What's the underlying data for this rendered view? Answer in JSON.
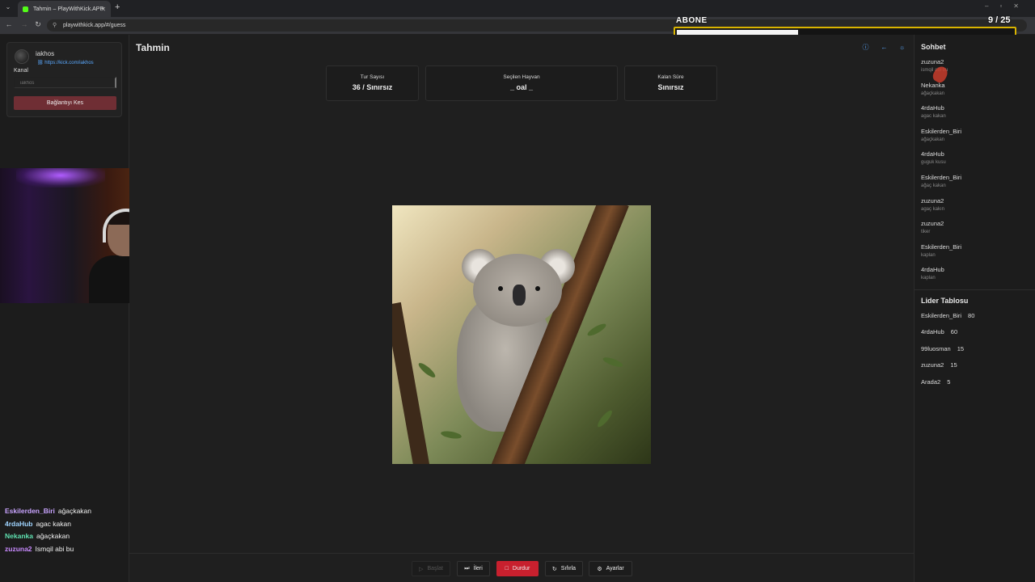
{
  "browser": {
    "tab_title": "Tahmin – PlayWithKick.APP",
    "url": "playwithkick.app/#/guess"
  },
  "overlay": {
    "abone_label": "ABONE",
    "abone_count": "9 / 25",
    "abone_progress": 0.36
  },
  "channel": {
    "name": "iakhos",
    "link": "https://kick.com/iakhos",
    "label": "Kanal",
    "input_placeholder": "iakhos",
    "disconnect_label": "Bağlantıyı Kes"
  },
  "stream_chat": [
    {
      "user": "Eskilerden_Biri",
      "message": "ağaçkakan",
      "color": "#c9a4ff"
    },
    {
      "user": "4rdaHub",
      "message": "agac kakan",
      "color": "#9fd4ff"
    },
    {
      "user": "Nekanka",
      "message": "ağaçkakan",
      "color": "#5fe0b0"
    },
    {
      "user": "zuzuna2",
      "message": "Ismqil abi bu",
      "color": "#c98bff"
    }
  ],
  "main": {
    "title": "Tahmin",
    "stats": [
      {
        "label": "Tur Sayısı",
        "value": "36 / Sınırsız"
      },
      {
        "label": "Seçilen Hayvan",
        "value": "_ oal _"
      },
      {
        "label": "Kalan Süre",
        "value": "Sınırsız"
      }
    ],
    "image_icon": "koala-photo"
  },
  "controls": {
    "start": "Başlat",
    "next": "İleri",
    "stop": "Durdur",
    "reset": "Sıfırla",
    "settings": "Ayarlar"
  },
  "chat": {
    "title": "Sohbet",
    "items": [
      {
        "user": "zuzuna2",
        "message": "ismqil abi bu"
      },
      {
        "user": "Nekanka",
        "message": "ağaçkakan"
      },
      {
        "user": "4rdaHub",
        "message": "agac kakan"
      },
      {
        "user": "Eskilerden_Biri",
        "message": "ağaçkakan"
      },
      {
        "user": "4rdaHub",
        "message": "guguk kusu"
      },
      {
        "user": "Eskilerden_Biri",
        "message": "ağaç kakan"
      },
      {
        "user": "zuzuna2",
        "message": "agaç kakın"
      },
      {
        "user": "zuzuna2",
        "message": "tiker"
      },
      {
        "user": "Eskilerden_Biri",
        "message": "kaplan"
      },
      {
        "user": "4rdaHub",
        "message": "kaplan"
      }
    ]
  },
  "leaderboard": {
    "title": "Lider Tablosu",
    "items": [
      {
        "user": "Eskilerden_Biri",
        "score": "80"
      },
      {
        "user": "4rdaHub",
        "score": "60"
      },
      {
        "user": "99luosman",
        "score": "15"
      },
      {
        "user": "zuzuna2",
        "score": "15"
      },
      {
        "user": "Arada2",
        "score": "5"
      }
    ]
  },
  "colors": {
    "accent": "#5aa9ff",
    "danger": "#c8202e",
    "kick_green": "#53fc18"
  }
}
